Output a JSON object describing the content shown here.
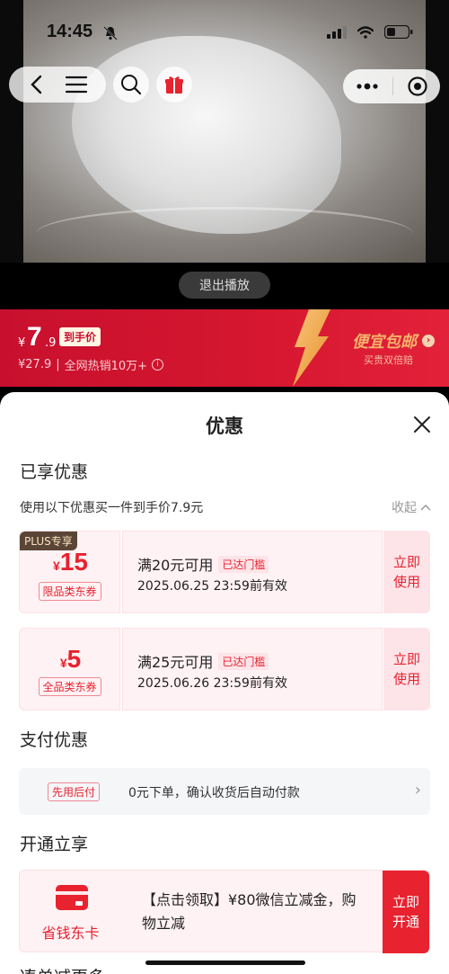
{
  "status": {
    "time": "14:45"
  },
  "video": {
    "exit_label": "退出播放"
  },
  "price_banner": {
    "currency": "¥",
    "price_int": "7",
    "price_dec": ".9",
    "tag": "到手价",
    "orig": "¥27.9",
    "sales": "全网热销10万+",
    "promo_title": "便宜包邮",
    "promo_sub": "买贵双倍赔"
  },
  "sheet": {
    "title": "优惠",
    "section_enjoyed": "已享优惠",
    "use_text": "使用以下优惠买一件到手价7.9元",
    "collapse": "收起",
    "coupons": [
      {
        "badge": "PLUS专享",
        "currency": "¥",
        "amount": "15",
        "type": "限品类东券",
        "condition": "满20元可用",
        "status": "已达门槛",
        "validity": "2025.06.25 23:59前有效",
        "action": [
          "立即",
          "使用"
        ]
      },
      {
        "badge": "",
        "currency": "¥",
        "amount": "5",
        "type": "全品类东券",
        "condition": "满25元可用",
        "status": "已达门槛",
        "validity": "2025.06.26 23:59前有效",
        "action": [
          "立即",
          "使用"
        ]
      }
    ],
    "section_pay": "支付优惠",
    "pay": {
      "tag": "先用后付",
      "text": "0元下单，确认收货后自动付款"
    },
    "section_open": "开通立享",
    "card": {
      "name": "省钱东卡",
      "text": "【点击领取】¥80微信立减金，购物立减",
      "action": [
        "立即",
        "开通"
      ]
    },
    "section_more": "凑单减更多"
  },
  "colors": {
    "brand_red": "#e8222f",
    "banner_red": "#c8102e",
    "gold": "#f4b26b"
  }
}
